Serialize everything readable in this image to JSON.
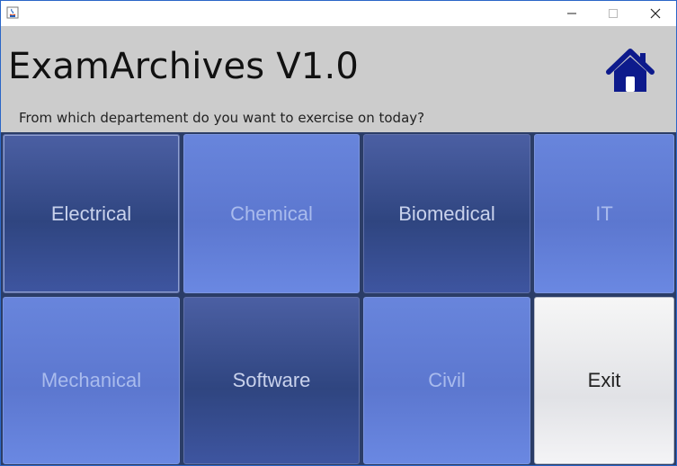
{
  "window": {
    "controls": {
      "minimize": "minimize-icon",
      "maximize": "maximize-icon",
      "close": "close-icon"
    }
  },
  "header": {
    "title": "ExamArchives V1.0",
    "subtitle": "From which departement do you want to exercise on today?",
    "home_icon": "home-icon",
    "home_color": "#0d1a8c"
  },
  "departments": {
    "electrical": "Electrical",
    "chemical": "Chemical",
    "biomedical": "Biomedical",
    "it": "IT",
    "mechanical": "Mechanical",
    "software": "Software",
    "civil": "Civil",
    "exit": "Exit"
  },
  "colors": {
    "dark_tile": "#33487f",
    "light_tile": "#6180d9",
    "exit_tile": "#e8e8ec",
    "header_bg": "#cccccc"
  }
}
